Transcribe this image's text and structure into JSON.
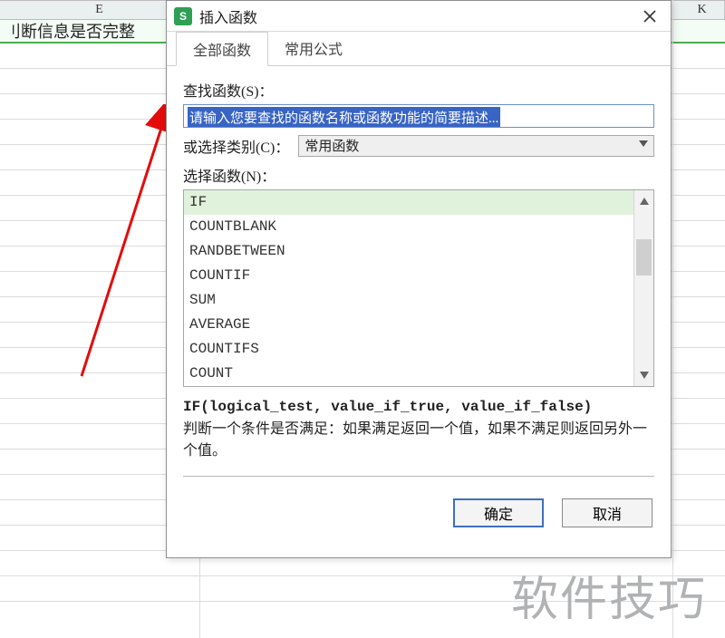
{
  "columns": {
    "E": "E",
    "K": "K"
  },
  "cell_E": "刂断信息是否完整",
  "dialog": {
    "title": "插入函数",
    "tabs": {
      "all": "全部函数",
      "common": "常用公式"
    },
    "search_label": "查找函数(S)：",
    "search_placeholder": "请输入您要查找的函数名称或函数功能的简要描述...",
    "category_label": "或选择类别(C)：",
    "category_value": "常用函数",
    "list_label": "选择函数(N)：",
    "functions": [
      "IF",
      "COUNTBLANK",
      "RANDBETWEEN",
      "COUNTIF",
      "SUM",
      "AVERAGE",
      "COUNTIFS",
      "COUNT"
    ],
    "signature": "IF(logical_test, value_if_true, value_if_false)",
    "description": "判断一个条件是否满足：如果满足返回一个值，如果不满足则返回另外一个值。",
    "ok": "确定",
    "cancel": "取消"
  },
  "watermark": "软件技巧"
}
